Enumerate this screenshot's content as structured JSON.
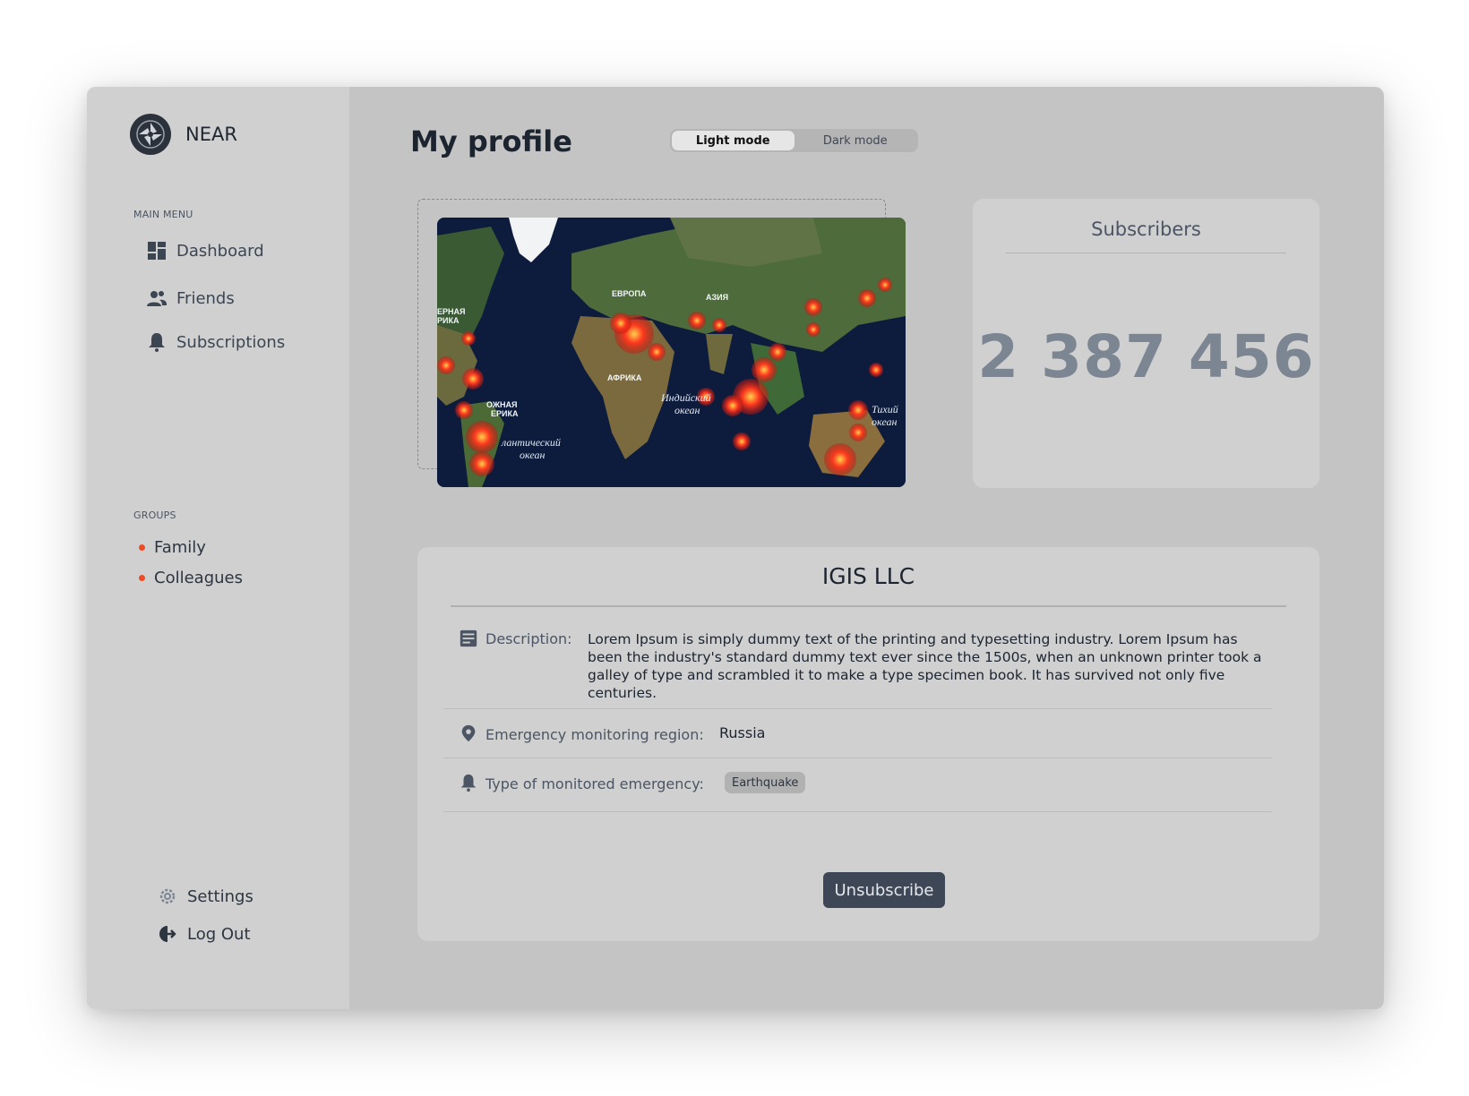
{
  "brand": {
    "name": "NEAR"
  },
  "sidebar": {
    "main_menu_title": "MAIN MENU",
    "items": [
      {
        "label": "Dashboard"
      },
      {
        "label": "Friends"
      },
      {
        "label": "Subscriptions"
      }
    ],
    "groups_title": "GROUPS",
    "groups": [
      {
        "label": "Family"
      },
      {
        "label": "Colleagues"
      }
    ],
    "settings_label": "Settings",
    "logout_label": "Log Out"
  },
  "header": {
    "title": "My profile",
    "mode_light": "Light mode",
    "mode_dark": "Dark mode",
    "active_mode": "light"
  },
  "subscribers": {
    "title": "Subscribers",
    "count": "2 387 456"
  },
  "map": {
    "labels": {
      "europe": "ЕВРОПА",
      "asia": "АЗИЯ",
      "africa": "АФРИКА",
      "indian_ocean_1": "Индийский",
      "indian_ocean_2": "океан",
      "atlantic_1": "лантический",
      "atlantic_2": "океан",
      "pacific_1": "Тихий",
      "pacific_2": "океан",
      "n_america_1": "ЕРНАЯ",
      "n_america_2": "РИКА",
      "s_america_1": "ОЖНАЯ",
      "s_america_2": "ЕРИКА"
    }
  },
  "company": {
    "name": "IGIS LLC",
    "description_label": "Description:",
    "description": "Lorem Ipsum is simply dummy text of the printing and typesetting industry. Lorem Ipsum has been the industry's standard dummy text ever since the 1500s, when an unknown printer took a galley of type and scrambled it to make a type specimen book. It has survived not only five centuries.",
    "region_label": "Emergency monitoring region:",
    "region_value": "Russia",
    "emergency_label": "Type of monitored emergency:",
    "emergency_value": "Earthquake",
    "unsubscribe_label": "Unsubscribe"
  },
  "colors": {
    "accent_dot": "#ef4a23",
    "button_bg": "#3e4756",
    "sidebar_bg": "#d0d0d0",
    "main_bg": "#c4c4c4"
  },
  "icons": {
    "dashboard": "dashboard-icon",
    "friends": "friends-icon",
    "subscriptions": "bell-icon",
    "settings": "gear-icon",
    "logout": "logout-icon",
    "description": "document-icon",
    "region": "location-pin-icon",
    "emergency": "bell-icon"
  }
}
